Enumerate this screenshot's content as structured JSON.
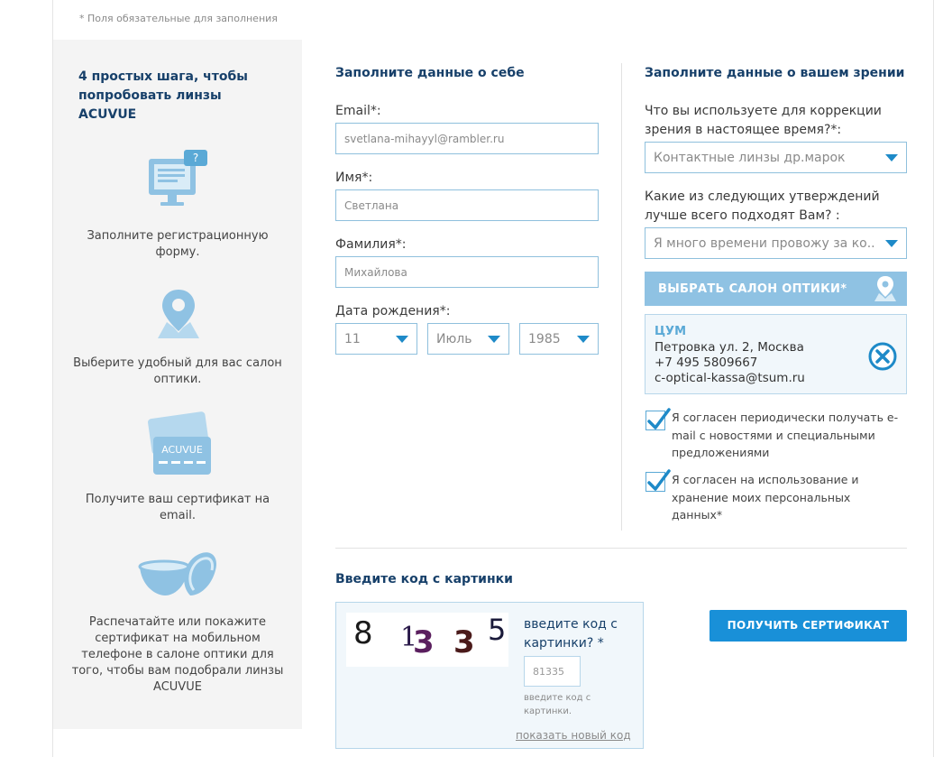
{
  "required_note": "* Поля обязательные для заполнения",
  "sidebar": {
    "title": "4 простых шага, чтобы попробовать линзы ACUVUE",
    "steps": [
      {
        "icon": "registration-form-icon",
        "text": "Заполните регистрационную форму."
      },
      {
        "icon": "location-pin-icon",
        "text": "Выберите удобный для вас салон оптики."
      },
      {
        "icon": "certificate-card-icon",
        "card_label": "ACUVUE",
        "text": "Получите ваш сертификат на email."
      },
      {
        "icon": "contact-lens-icon",
        "text": "Распечатайте или покажите сертификат на мобильном телефоне  в салоне оптики для того, чтобы вам подобрали линзы ACUVUE"
      }
    ]
  },
  "personal": {
    "title": "Заполните данные о себе",
    "email": {
      "label": "Email*:",
      "value": "svetlana-mihayyl@rambler.ru"
    },
    "first_name": {
      "label": "Имя*:",
      "value": "Светлана"
    },
    "last_name": {
      "label": "Фамилия*:",
      "value": "Михайлова"
    },
    "birthdate": {
      "label": "Дата рождения*:",
      "day": "11",
      "month": "Июль",
      "year": "1985"
    }
  },
  "vision": {
    "title": "Заполните данные о вашем зрении",
    "correction_question": "Что вы используете для коррекции зрения в настоящее время?*:",
    "correction_value": "Контактные линзы др.марок",
    "statement_question": "Какие из следующих утверждений лучше всего подходят Вам? :",
    "statement_value": "Я много времени провожу за ко...",
    "salon_button": "ВЫБРАТЬ САЛОН ОПТИКИ*",
    "salon": {
      "name": "ЦУМ",
      "address": "Петровка ул. 2, Москва",
      "phone": "+7 495 5809667",
      "email": "c-optical-kassa@tsum.ru"
    },
    "consent_news": "Я согласен периодически получать e-mail с новостями и специальными предложениями",
    "consent_data": "Я согласен на использование и хранение моих персональных данных*"
  },
  "captcha": {
    "title": "Введите код с картинки",
    "digits": [
      "8",
      "1",
      "3",
      "3",
      "5"
    ],
    "label": "введите код с картинки? *",
    "value": "81335",
    "hint": "введите код с картинки.",
    "refresh": "показать новый код"
  },
  "submit": "ПОЛУЧИТЬ СЕРТИФИКАТ",
  "colors": {
    "title_blue": "#17406a",
    "accent_blue": "#1990d8",
    "icon_blue": "#8fc2e3",
    "field_border": "#8fc0dd"
  }
}
